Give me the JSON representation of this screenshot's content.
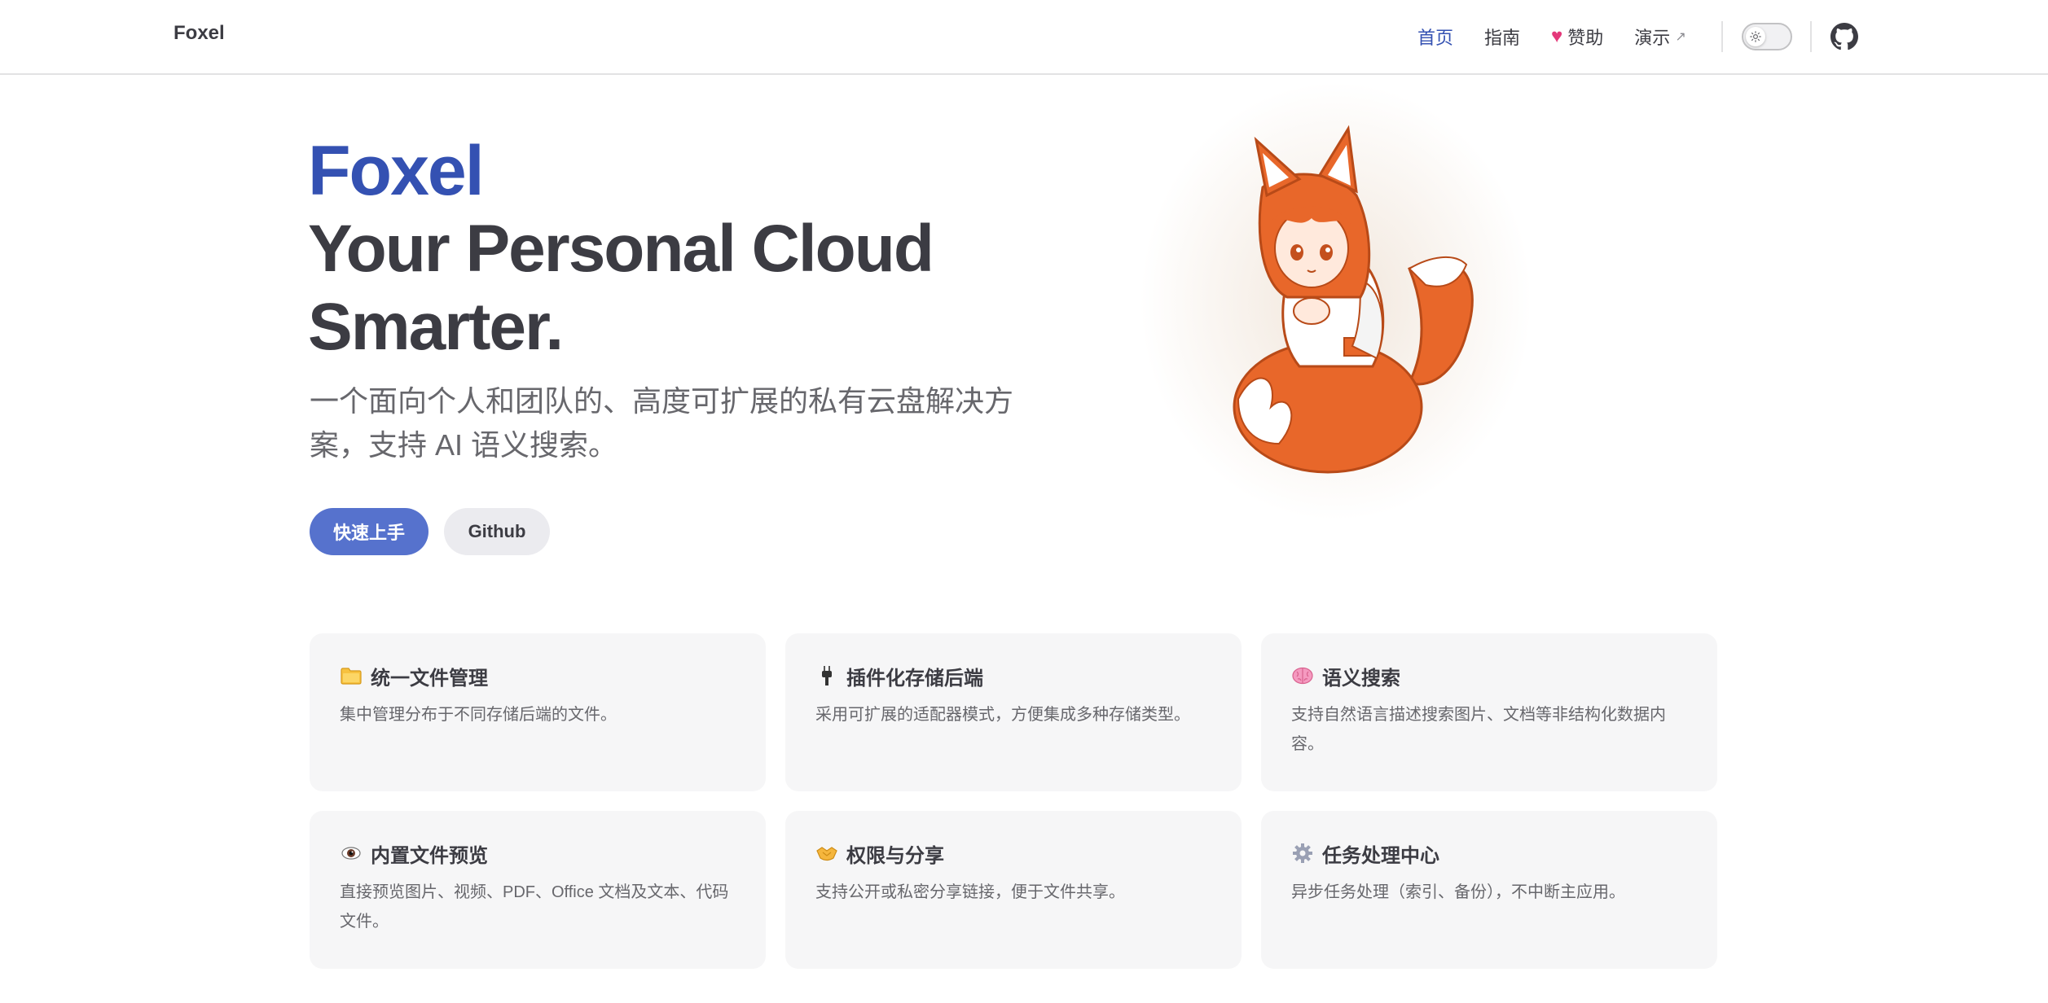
{
  "nav": {
    "brand": "Foxel",
    "links": [
      {
        "label": "首页",
        "active": true
      },
      {
        "label": "指南"
      },
      {
        "label": "赞助",
        "icon": "heart-icon"
      },
      {
        "label": "演示",
        "external_marker": "↗"
      }
    ],
    "theme_toggle": {
      "icon": "sun-icon"
    },
    "github_icon": "github-icon"
  },
  "hero": {
    "name": "Foxel",
    "title_line1": "Your Personal Cloud",
    "title_line2": "Smarter.",
    "tagline": "一个面向个人和团队的、高度可扩展的私有云盘解决方案，支持 AI 语义搜索。",
    "primary_button": "快速上手",
    "secondary_button": "Github",
    "image": "fox-girl-mascot"
  },
  "features": [
    {
      "icon": "folder-icon",
      "title": "统一文件管理",
      "desc": "集中管理分布于不同存储后端的文件。"
    },
    {
      "icon": "plug-icon",
      "title": "插件化存储后端",
      "desc": "采用可扩展的适配器模式，方便集成多种存储类型。"
    },
    {
      "icon": "brain-icon",
      "title": "语义搜索",
      "desc": "支持自然语言描述搜索图片、文档等非结构化数据内容。"
    },
    {
      "icon": "eye-icon",
      "title": "内置文件预览",
      "desc": "直接预览图片、视频、PDF、Office 文档及文本、代码文件。"
    },
    {
      "icon": "handshake-icon",
      "title": "权限与分享",
      "desc": "支持公开或私密分享链接，便于文件共享。"
    },
    {
      "icon": "gear-icon",
      "title": "任务处理中心",
      "desc": "异步任务处理（索引、备份），不中断主应用。"
    }
  ],
  "colors": {
    "brand": "#3451b2",
    "primary_button": "#5672cd",
    "fox_orange": "#e8672a"
  }
}
